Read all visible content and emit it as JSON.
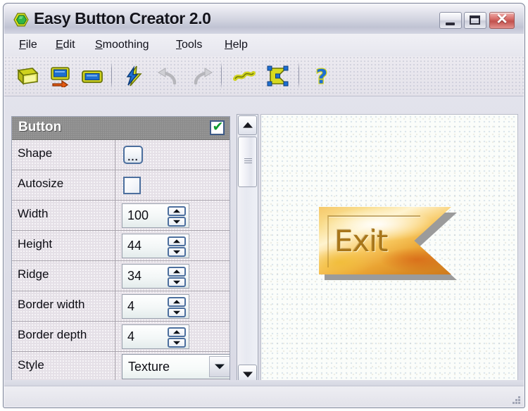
{
  "window": {
    "title": "Easy Button Creator 2.0",
    "icon": "hexagon-app-icon",
    "controls": {
      "minimize": "minimize-button",
      "maximize": "maximize-button",
      "close_glyph": "✕"
    }
  },
  "menubar": {
    "items": [
      {
        "label": "File",
        "mnemonic": "F"
      },
      {
        "label": "Edit",
        "mnemonic": "E"
      },
      {
        "label": "Smoothing",
        "mnemonic": "S"
      },
      {
        "label": "Tools",
        "mnemonic": "T"
      },
      {
        "label": "Help",
        "mnemonic": "H"
      }
    ]
  },
  "toolbar": {
    "buttons": [
      {
        "name": "new-button-icon",
        "tooltip": "New"
      },
      {
        "name": "open-export-icon",
        "tooltip": "Export"
      },
      {
        "name": "save-button-icon",
        "tooltip": "Save"
      },
      {
        "name": "apply-flash-icon",
        "tooltip": "Apply"
      },
      {
        "name": "undo-icon",
        "tooltip": "Undo"
      },
      {
        "name": "redo-icon",
        "tooltip": "Redo"
      },
      {
        "name": "link-icon",
        "tooltip": "Link"
      },
      {
        "name": "shape-nodes-icon",
        "tooltip": "Edit shape"
      },
      {
        "name": "help-question-icon",
        "tooltip": "Help"
      }
    ]
  },
  "panel": {
    "header": {
      "title": "Button",
      "checkbox_checked": true,
      "check_glyph": "✔"
    },
    "rows": [
      {
        "name": "Shape",
        "type": "ellipsis",
        "value": "..."
      },
      {
        "name": "Autosize",
        "type": "checkbox",
        "value": ""
      },
      {
        "name": "Width",
        "type": "spinner",
        "value": "100"
      },
      {
        "name": "Height",
        "type": "spinner",
        "value": "44"
      },
      {
        "name": "Ridge",
        "type": "spinner",
        "value": "34"
      },
      {
        "name": "Border width",
        "type": "spinner",
        "value": "4"
      },
      {
        "name": "Border depth",
        "type": "spinner",
        "value": "4"
      },
      {
        "name": "Style",
        "type": "combo",
        "value": "Texture"
      }
    ]
  },
  "scrollbar": {
    "up_name": "scroll-up-button",
    "down_name": "scroll-down-button",
    "thumb_name": "scroll-thumb"
  },
  "canvas": {
    "preview": {
      "label": "Exit",
      "shape": "arrow-notch-rectangle",
      "style": "Texture",
      "width": "100",
      "height": "44"
    }
  },
  "statusbar": {
    "text": ""
  },
  "colors": {
    "title_gradient_top": "#f4f4f8",
    "title_gradient_bottom": "#c0c3d3",
    "close_button": "#c1514d",
    "panel_header": "#8b8b8b",
    "panel_row": "#e5e0e7",
    "check_green": "#0f9b2e",
    "preview_gold": "#f7c65c",
    "preview_orange": "#cf7a1c",
    "preview_text": "#a8761a"
  }
}
